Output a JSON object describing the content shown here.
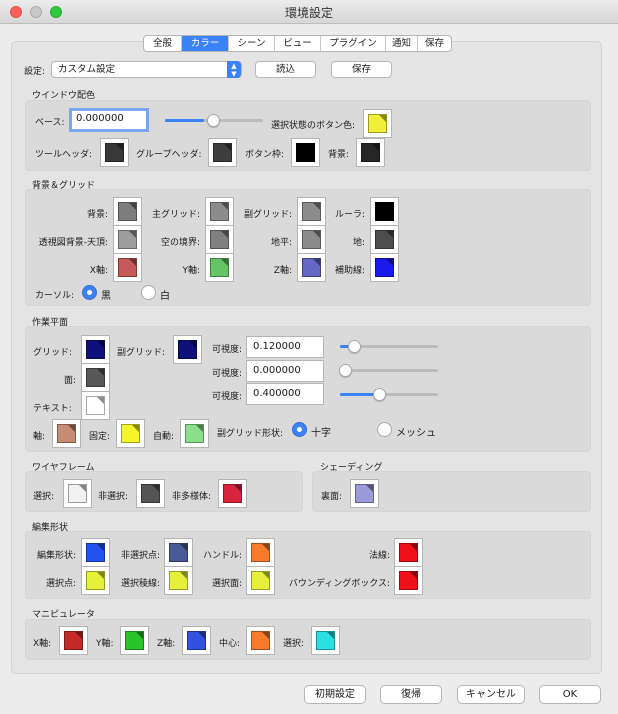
{
  "window": {
    "title": "環境設定"
  },
  "colors": {
    "accent": "#3b82f6",
    "close": "#fc5f57",
    "minimize": "#c9c9c9",
    "zoom": "#2fc840"
  },
  "tabs": [
    "全般",
    "カラー",
    "シーン",
    "ビュー",
    "プラグイン",
    "通知",
    "保存"
  ],
  "active_tab": "カラー",
  "settings": {
    "label": "設定:",
    "value": "カスタム設定",
    "load": "読込",
    "save": "保存"
  },
  "window_colors": {
    "title": "ウインドウ配色",
    "base_label": "ベース:",
    "base_value": "0.000000",
    "base_slider": 0.4,
    "selected_button_label": "選択状態のボタン色:",
    "selected_button_color": "#f0f03a",
    "items": [
      {
        "label": "ツールヘッダ:",
        "color": "#383838"
      },
      {
        "label": "グループヘッダ:",
        "color": "#3e3e3e"
      },
      {
        "label": "ボタン枠:",
        "color": "#000000"
      },
      {
        "label": "背景:",
        "color": "#262626"
      }
    ]
  },
  "background_grid": {
    "title": "背景＆グリッド",
    "items": [
      {
        "label": "背景:",
        "color": "#7d7d7d"
      },
      {
        "label": "主グリッド:",
        "color": "#8c8c8c"
      },
      {
        "label": "副グリッド:",
        "color": "#8c8c8c"
      },
      {
        "label": "ルーラ:",
        "color": "#000000"
      },
      {
        "label": "透視図背景-天頂:",
        "color": "#9e9e9e"
      },
      {
        "label": "空の境界:",
        "color": "#808080"
      },
      {
        "label": "地平:",
        "color": "#8c8c8c"
      },
      {
        "label": "地:",
        "color": "#4d4d4d"
      },
      {
        "label": "X軸:",
        "color": "#c55a5a"
      },
      {
        "label": "Y軸:",
        "color": "#66c466"
      },
      {
        "label": "Z軸:",
        "color": "#6666c4"
      },
      {
        "label": "補助線:",
        "color": "#1a1aee"
      }
    ],
    "cursor_label": "カーソル:",
    "cursor_options": [
      "黒",
      "白"
    ],
    "cursor_selected": "黒"
  },
  "work_plane": {
    "title": "作業平面",
    "grid_label": "グリッド:",
    "grid_color": "#10107a",
    "subgrid_label": "副グリッド:",
    "subgrid_color": "#10107a",
    "face_label": "面:",
    "face_color": "#585858",
    "text_label": "テキスト:",
    "text_color": "#ffffff",
    "visibility": [
      {
        "label": "可視度:",
        "value": "0.120000",
        "level": 0.12
      },
      {
        "label": "可視度:",
        "value": "0.000000",
        "level": 0.0
      },
      {
        "label": "可視度:",
        "value": "0.400000",
        "level": 0.4
      }
    ],
    "axis_label": "軸:",
    "axis_color": "#c48d73",
    "fixed_label": "固定:",
    "fixed_color": "#f5f52a",
    "auto_label": "自動:",
    "auto_color": "#8ae08a",
    "subgrid_shape_label": "副グリッド形状:",
    "subgrid_shape_options": [
      "十字",
      "メッシュ"
    ],
    "subgrid_shape_selected": "十字"
  },
  "wireframe": {
    "title": "ワイヤフレーム",
    "items": [
      {
        "label": "選択:",
        "color": "#f2f2f2"
      },
      {
        "label": "非選択:",
        "color": "#545454"
      },
      {
        "label": "非多様体:",
        "color": "#d9243e"
      }
    ]
  },
  "shading": {
    "title": "シェーディング",
    "back_label": "裏面:",
    "back_color": "#9a9ad6"
  },
  "edit_shape": {
    "title": "編集形状",
    "items": [
      {
        "label": "編集形状:",
        "color": "#2450f0"
      },
      {
        "label": "非選択点:",
        "color": "#4a5a96"
      },
      {
        "label": "ハンドル:",
        "color": "#f57c2a"
      },
      {
        "label": "法線:",
        "color": "#f0101a"
      },
      {
        "label": "選択点:",
        "color": "#e6f03a"
      },
      {
        "label": "選択稜線:",
        "color": "#e6f03a"
      },
      {
        "label": "選択面:",
        "color": "#e6f03a"
      },
      {
        "label": "バウンディングボックス:",
        "color": "#f0101a"
      }
    ]
  },
  "manipulator": {
    "title": "マニピュレータ",
    "items": [
      {
        "label": "X軸:",
        "color": "#c42a2a"
      },
      {
        "label": "Y軸:",
        "color": "#2ac42a"
      },
      {
        "label": "Z軸:",
        "color": "#3450e0"
      },
      {
        "label": "中心:",
        "color": "#f57c2a"
      },
      {
        "label": "選択:",
        "color": "#2ae0e0"
      }
    ]
  },
  "footer": {
    "defaults": "初期設定",
    "revert": "復帰",
    "cancel": "キャンセル",
    "ok": "OK"
  }
}
